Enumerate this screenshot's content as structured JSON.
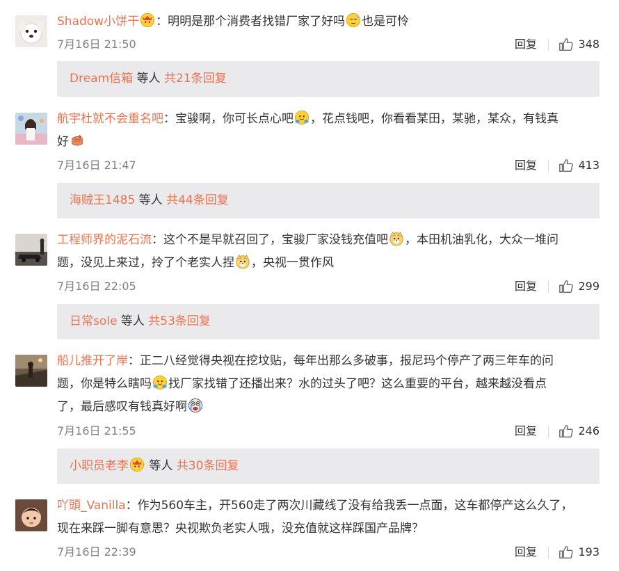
{
  "comments": [
    {
      "username": "Shadow小饼干",
      "line1": "：明明是那个消费者找错厂家了好吗",
      "line1b": "也是可怜",
      "time": "7月16日 21:50",
      "reply_label": "回复",
      "likes": "348",
      "sub": {
        "name": "Dream信箱",
        "mid": " 等人 ",
        "total": "共21条回复"
      }
    },
    {
      "username": "航宇杜就不会重名吧",
      "line1": "：宝骏啊，你可长点心吧",
      "line1b": "，花点钱吧，你看看某田，某驰，某众，有钱真",
      "line2": "好",
      "time": "7月16日 21:47",
      "reply_label": "回复",
      "likes": "413",
      "sub": {
        "name": "海贼王1485",
        "mid": " 等人 ",
        "total": "共44条回复"
      }
    },
    {
      "username": "工程师界的泥石流",
      "line1": "：这个不是早就召回了，宝骏厂家没钱充值吧",
      "line1b": "，本田机油乳化，大众一堆问",
      "line2": "题，没见上来过，拎了个老实人捏",
      "line2b": "，央视一贯作风",
      "time": "7月16日 22:05",
      "reply_label": "回复",
      "likes": "299",
      "sub": {
        "name": "日常sole",
        "mid": " 等人 ",
        "total": "共53条回复"
      }
    },
    {
      "username": "船儿推开了岸",
      "line1": "：正二八经觉得央视在挖坟贴，每年出那么多破事，报尼玛个停产了两三年车的问",
      "line2": "题，你是特么瞎吗",
      "line2b": "找厂家找错了还播出来？水的过头了吧？这么重要的平台，越来越没看点",
      "line3": "了，最后感叹有钱真好啊",
      "time": "7月16日 21:55",
      "reply_label": "回复",
      "likes": "246",
      "sub": {
        "name": "小职员老李",
        "mid": " 等人 ",
        "total": "共30条回复"
      }
    },
    {
      "username": "吖頭_Vanilla",
      "line1": "：作为560车主，开560走了两次川藏线了没有给我丢一点面，这车都停产这么久了，",
      "line2": "现在来踩一脚有意思？央视欺负老实人哦，没充值就这样踩国产品牌？",
      "time": "7月16日 22:39",
      "reply_label": "回复",
      "likes": "193"
    }
  ],
  "icons": {
    "like": "thumbs-up-icon",
    "emoji_sweat": "sweat-emoji-icon",
    "emoji_hug": "hug-emoji-icon",
    "emoji_doge": "doge-emoji-icon",
    "emoji_crying": "crying-emoji-icon",
    "emoji_fist": "fist-emoji-icon",
    "badge_crown": "crown-badge-icon"
  },
  "colors": {
    "username": "#eb7350",
    "subbar_bg": "#eaeaec",
    "meta_text": "#808080"
  }
}
